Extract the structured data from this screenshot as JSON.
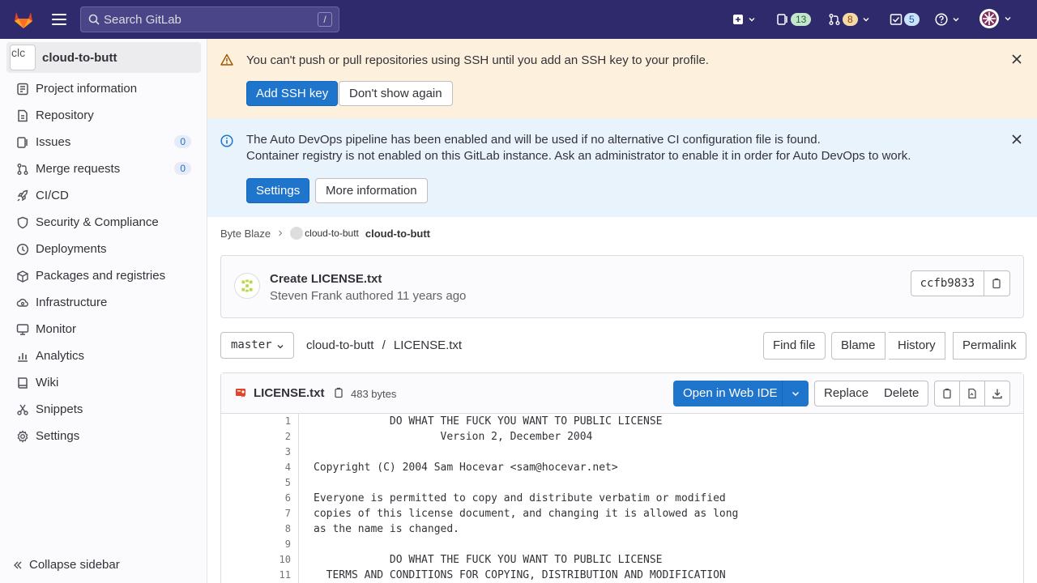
{
  "topbar": {
    "search_placeholder": "Search GitLab",
    "search_shortcut": "/",
    "issues_count": "13",
    "mr_count": "8",
    "todo_count": "5",
    "colors": {
      "bg": "#2f2a6b",
      "issues_pill": "#c3e6cd",
      "mr_pill": "#f5d9a8",
      "todo_pill": "#cbe2f9"
    }
  },
  "sidebar": {
    "project_avatar_alt": "clc",
    "project_name": "cloud-to-butt",
    "items": [
      {
        "label": "Project information",
        "icon": "project-icon"
      },
      {
        "label": "Repository",
        "icon": "document-icon"
      },
      {
        "label": "Issues",
        "icon": "issues-icon",
        "badge": "0"
      },
      {
        "label": "Merge requests",
        "icon": "merge-request-icon",
        "badge": "0"
      },
      {
        "label": "CI/CD",
        "icon": "rocket-icon"
      },
      {
        "label": "Security & Compliance",
        "icon": "shield-icon"
      },
      {
        "label": "Deployments",
        "icon": "deployments-icon"
      },
      {
        "label": "Packages and registries",
        "icon": "package-icon"
      },
      {
        "label": "Infrastructure",
        "icon": "cloud-gear-icon"
      },
      {
        "label": "Monitor",
        "icon": "monitor-icon"
      },
      {
        "label": "Analytics",
        "icon": "chart-icon"
      },
      {
        "label": "Wiki",
        "icon": "book-icon"
      },
      {
        "label": "Snippets",
        "icon": "snippet-icon"
      },
      {
        "label": "Settings",
        "icon": "gear-icon"
      }
    ],
    "collapse_label": "Collapse sidebar"
  },
  "ssh_alert": {
    "text": "You can't push or pull repositories using SSH until you add an SSH key to your profile.",
    "primary": "Add SSH key",
    "secondary": "Don't show again"
  },
  "devops_alert": {
    "line1": "The Auto DevOps pipeline has been enabled and will be used if no alternative CI configuration file is found.",
    "line2": "Container registry is not enabled on this GitLab instance. Ask an administrator to enable it in order for Auto DevOps to work.",
    "primary": "Settings",
    "secondary": "More information"
  },
  "breadcrumb": {
    "group": "Byte Blaze",
    "project_img_alt": "cloud-to-butt",
    "current": "cloud-to-butt"
  },
  "commit": {
    "title": "Create LICENSE.txt",
    "meta": "Steven Frank authored 11 years ago",
    "sha": "ccfb9833"
  },
  "file_nav": {
    "branch": "master",
    "path_repo": "cloud-to-butt",
    "path_sep": "/",
    "path_file": "LICENSE.txt",
    "buttons": [
      "Find file",
      "Blame",
      "History",
      "Permalink"
    ]
  },
  "file": {
    "name": "LICENSE.txt",
    "size": "483 bytes",
    "open_ide": "Open in Web IDE",
    "replace": "Replace",
    "delete": "Delete",
    "lines": [
      "            DO WHAT THE FUCK YOU WANT TO PUBLIC LICENSE",
      "                    Version 2, December 2004",
      "",
      "Copyright (C) 2004 Sam Hocevar <sam@hocevar.net>",
      "",
      "Everyone is permitted to copy and distribute verbatim or modified",
      "copies of this license document, and changing it is allowed as long",
      "as the name is changed.",
      "",
      "            DO WHAT THE FUCK YOU WANT TO PUBLIC LICENSE",
      "  TERMS AND CONDITIONS FOR COPYING, DISTRIBUTION AND MODIFICATION"
    ],
    "line_numbers": [
      "1",
      "2",
      "3",
      "4",
      "5",
      "6",
      "7",
      "8",
      "9",
      "10",
      "11"
    ]
  }
}
